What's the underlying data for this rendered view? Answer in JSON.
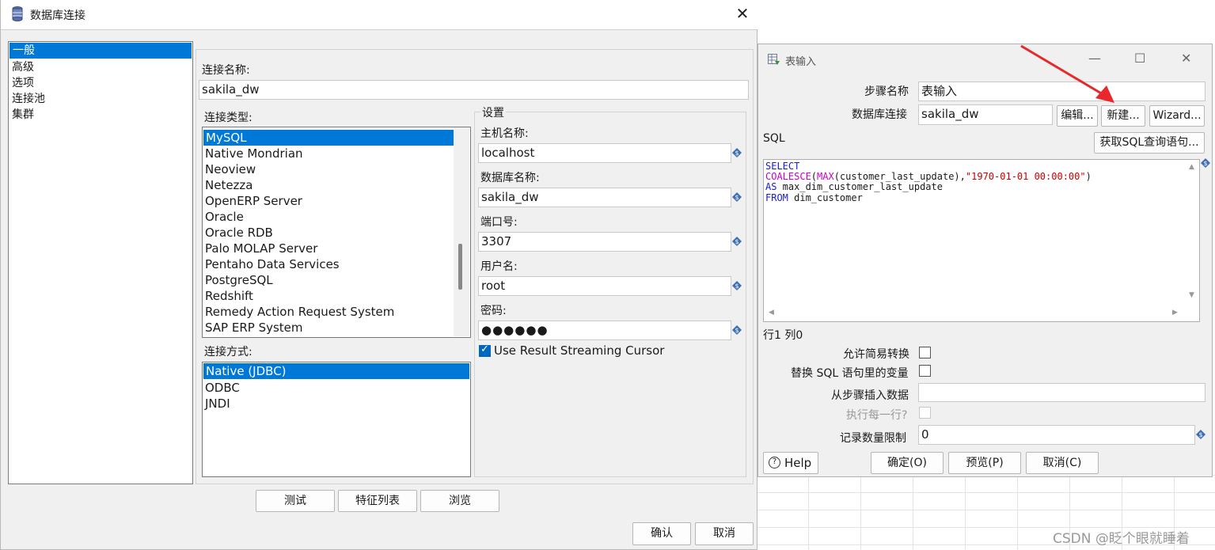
{
  "db_dialog": {
    "title": "数据库连接",
    "close_icon": "✕",
    "nav_items": [
      "一般",
      "高级",
      "选项",
      "连接池",
      "集群"
    ],
    "conn_name_label": "连接名称:",
    "conn_name_value": "sakila_dw",
    "conn_type_label": "连接类型:",
    "conn_types": [
      "MySQL",
      "Native Mondrian",
      "Neoview",
      "Netezza",
      "OpenERP Server",
      "Oracle",
      "Oracle RDB",
      "Palo MOLAP Server",
      "Pentaho Data Services",
      "PostgreSQL",
      "Redshift",
      "Remedy Action Request System",
      "SAP ERP System"
    ],
    "access_label": "连接方式:",
    "access_types": [
      "Native (JDBC)",
      "ODBC",
      "JNDI"
    ],
    "settings_legend": "设置",
    "host_label": "主机名称:",
    "host_value": "localhost",
    "dbname_label": "数据库名称:",
    "dbname_value": "sakila_dw",
    "port_label": "端口号:",
    "port_value": "3307",
    "user_label": "用户名:",
    "user_value": "root",
    "password_label": "密码:",
    "password_value": "●●●●●●",
    "streaming_label": "Use Result Streaming Cursor",
    "streaming_checked": true,
    "test_button": "测试",
    "features_button": "特征列表",
    "explore_button": "浏览",
    "ok_button": "确认",
    "cancel_button": "取消"
  },
  "table_input": {
    "title": "表输入",
    "minimize_icon": "—",
    "maximize_icon": "☐",
    "close_icon": "✕",
    "step_name_label": "步骤名称",
    "step_name_value": "表输入",
    "db_conn_label": "数据库连接",
    "db_conn_value": "sakila_dw",
    "edit_button": "编辑...",
    "new_button": "新建...",
    "wizard_button": "Wizard...",
    "sql_label": "SQL",
    "get_sql_button": "获取SQL查询语句...",
    "sql_lines": [
      [
        "SELECT"
      ],
      [
        "COALESCE",
        "(",
        "MAX",
        "(customer_last_update),",
        "\"1970-01-01 00:00:00\"",
        ")"
      ],
      [
        "AS",
        " max_dim_customer_last_update"
      ],
      [
        "FROM",
        " dim_customer"
      ]
    ],
    "cursor_pos": "行1 列0",
    "lazy_conv_label": "允许简易转换",
    "replace_vars_label": "替换 SQL 语句里的变量",
    "insert_from_label": "从步骤插入数据",
    "exec_each_label": "执行每一行?",
    "limit_label": "记录数量限制",
    "limit_value": "0",
    "help_button": "Help",
    "ok_button": "确定(O)",
    "preview_button": "预览(P)",
    "cancel_button": "取消(C)"
  },
  "watermark": "CSDN @眨个眼就睡着"
}
